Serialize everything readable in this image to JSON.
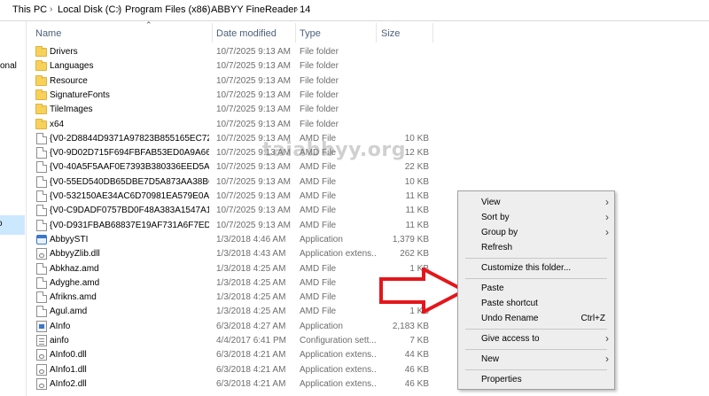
{
  "breadcrumb": {
    "items": [
      "This PC",
      "Local Disk (C:)",
      "Program Files (x86)",
      "ABBYY FineReader 14"
    ],
    "separator": "›"
  },
  "nav": {
    "cropped_label": "onal",
    "selected_glyph": "o"
  },
  "columns": {
    "name": "Name",
    "date": "Date modified",
    "type": "Type",
    "size": "Size"
  },
  "files": [
    {
      "icon": "folder",
      "name": "Drivers",
      "date": "10/7/2025 9:13 AM",
      "type": "File folder",
      "size": ""
    },
    {
      "icon": "folder",
      "name": "Languages",
      "date": "10/7/2025 9:13 AM",
      "type": "File folder",
      "size": ""
    },
    {
      "icon": "folder",
      "name": "Resource",
      "date": "10/7/2025 9:13 AM",
      "type": "File folder",
      "size": ""
    },
    {
      "icon": "folder",
      "name": "SignatureFonts",
      "date": "10/7/2025 9:13 AM",
      "type": "File folder",
      "size": ""
    },
    {
      "icon": "folder",
      "name": "TileImages",
      "date": "10/7/2025 9:13 AM",
      "type": "File folder",
      "size": ""
    },
    {
      "icon": "folder",
      "name": "x64",
      "date": "10/7/2025 9:13 AM",
      "type": "File folder",
      "size": ""
    },
    {
      "icon": "file",
      "name": "{V0-2D8844D9371A97823B855165EC727A...",
      "date": "10/7/2025 9:13 AM",
      "type": "AMD File",
      "size": "10 KB"
    },
    {
      "icon": "file",
      "name": "{V0-9D02D715F694FBFAB53ED0A9A6652B...",
      "date": "10/7/2025 9:13 AM",
      "type": "AMD File",
      "size": "12 KB"
    },
    {
      "icon": "file",
      "name": "{V0-40A5F5AAF0E7393B380336EED5AD26...",
      "date": "10/7/2025 9:13 AM",
      "type": "AMD File",
      "size": "22 KB"
    },
    {
      "icon": "file",
      "name": "{V0-55ED540DB65DBE7D5A873AA38BC76...",
      "date": "10/7/2025 9:13 AM",
      "type": "AMD File",
      "size": "10 KB"
    },
    {
      "icon": "file",
      "name": "{V0-532150AE34AC6D70981EA579E0A258...",
      "date": "10/7/2025 9:13 AM",
      "type": "AMD File",
      "size": "11 KB"
    },
    {
      "icon": "file",
      "name": "{V0-C9DADF0757BD0F48A383A1547A12A...",
      "date": "10/7/2025 9:13 AM",
      "type": "AMD File",
      "size": "11 KB"
    },
    {
      "icon": "file",
      "name": "{V0-D931FBAB68837E19AF731A6F7EDEC9...",
      "date": "10/7/2025 9:13 AM",
      "type": "AMD File",
      "size": "11 KB"
    },
    {
      "icon": "app",
      "name": "AbbyySTI",
      "date": "1/3/2018 4:46 AM",
      "type": "Application",
      "size": "1,379 KB"
    },
    {
      "icon": "dll",
      "name": "AbbyyZlib.dll",
      "date": "1/3/2018 4:43 AM",
      "type": "Application extens...",
      "size": "262 KB"
    },
    {
      "icon": "file",
      "name": "Abkhaz.amd",
      "date": "1/3/2018 4:25 AM",
      "type": "AMD File",
      "size": "1 KB"
    },
    {
      "icon": "file",
      "name": "Adyghe.amd",
      "date": "1/3/2018 4:25 AM",
      "type": "AMD File",
      "size": "1 KB"
    },
    {
      "icon": "file",
      "name": "Afrikns.amd",
      "date": "1/3/2018 4:25 AM",
      "type": "AMD File",
      "size": "1 KB"
    },
    {
      "icon": "file",
      "name": "Agul.amd",
      "date": "1/3/2018 4:25 AM",
      "type": "AMD File",
      "size": "1 KB"
    },
    {
      "icon": "app2",
      "name": "AInfo",
      "date": "6/3/2018 4:27 AM",
      "type": "Application",
      "size": "2,183 KB"
    },
    {
      "icon": "cfg",
      "name": "ainfo",
      "date": "4/4/2017 6:41 PM",
      "type": "Configuration sett...",
      "size": "7 KB"
    },
    {
      "icon": "dll",
      "name": "AInfo0.dll",
      "date": "6/3/2018 4:21 AM",
      "type": "Application extens...",
      "size": "44 KB"
    },
    {
      "icon": "dll",
      "name": "AInfo1.dll",
      "date": "6/3/2018 4:21 AM",
      "type": "Application extens...",
      "size": "46 KB"
    },
    {
      "icon": "dll",
      "name": "AInfo2.dll",
      "date": "6/3/2018 4:21 AM",
      "type": "Application extens...",
      "size": "46 KB"
    }
  ],
  "watermark": "taiabbyy.org",
  "context_menu": {
    "items": [
      {
        "label": "View",
        "submenu": true
      },
      {
        "label": "Sort by",
        "submenu": true
      },
      {
        "label": "Group by",
        "submenu": true
      },
      {
        "label": "Refresh"
      },
      {
        "separator": true
      },
      {
        "label": "Customize this folder..."
      },
      {
        "separator": true
      },
      {
        "label": "Paste"
      },
      {
        "label": "Paste shortcut"
      },
      {
        "label": "Undo Rename",
        "shortcut": "Ctrl+Z"
      },
      {
        "separator": true
      },
      {
        "label": "Give access to",
        "submenu": true
      },
      {
        "separator": true
      },
      {
        "label": "New",
        "submenu": true
      },
      {
        "separator": true
      },
      {
        "label": "Properties"
      }
    ],
    "submenu_glyph": "›"
  },
  "colors": {
    "arrow_red": "#e4161b",
    "nav_selected": "#cce8ff",
    "header_text": "#4c607a"
  }
}
